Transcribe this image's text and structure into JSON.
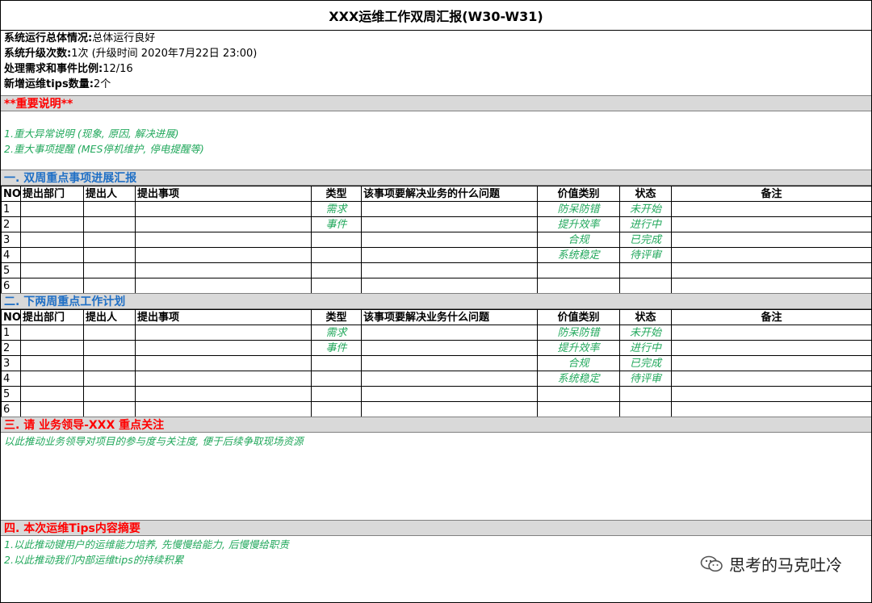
{
  "title": "XXX运维工作双周汇报(W30-W31)",
  "summary": [
    {
      "label": "系统运行总体情况:",
      "value": "总体运行良好"
    },
    {
      "label": "系统升级次数:",
      "value": "1次 (升级时间 2020年7月22日 23:00)"
    },
    {
      "label": "处理需求和事件比例:",
      "value": "12/16"
    },
    {
      "label": "新增运维tips数量:",
      "value": "2个"
    }
  ],
  "important": {
    "heading": "**重要说明**",
    "notes": [
      "1.重大异常说明 (现象, 原因, 解决进展)",
      "2.重大事项提醒 (MES停机维护, 停电提醒等)"
    ]
  },
  "section1": {
    "heading": "一. 双周重点事项进展汇报",
    "columns": [
      "NO",
      "提出部门",
      "提出人",
      "提出事项",
      "类型",
      "该事项要解决业务的什么问题",
      "价值类别",
      "状态",
      "备注"
    ],
    "rows": [
      {
        "no": "1",
        "type": "需求",
        "value": "防呆防错",
        "status": "未开始"
      },
      {
        "no": "2",
        "type": "事件",
        "value": "提升效率",
        "status": "进行中"
      },
      {
        "no": "3",
        "type": "",
        "value": "合规",
        "status": "已完成"
      },
      {
        "no": "4",
        "type": "",
        "value": "系统稳定",
        "status": "待评审"
      },
      {
        "no": "5",
        "type": "",
        "value": "",
        "status": ""
      },
      {
        "no": "6",
        "type": "",
        "value": "",
        "status": ""
      }
    ]
  },
  "section2": {
    "heading": "二. 下两周重点工作计划",
    "columns": [
      "NO",
      "提出部门",
      "提出人",
      "提出事项",
      "类型",
      "该事项要解决业务什么问题",
      "价值类别",
      "状态",
      "备注"
    ],
    "rows": [
      {
        "no": "1",
        "type": "需求",
        "value": "防呆防错",
        "status": "未开始"
      },
      {
        "no": "2",
        "type": "事件",
        "value": "提升效率",
        "status": "进行中"
      },
      {
        "no": "3",
        "type": "",
        "value": "合规",
        "status": "已完成"
      },
      {
        "no": "4",
        "type": "",
        "value": "系统稳定",
        "status": "待评审"
      },
      {
        "no": "5",
        "type": "",
        "value": "",
        "status": ""
      },
      {
        "no": "6",
        "type": "",
        "value": "",
        "status": ""
      }
    ]
  },
  "section3": {
    "heading": "三. 请 业务领导-XXX 重点关注",
    "note": "以此推动业务领导对项目的参与度与关注度, 便于后续争取现场资源"
  },
  "section4": {
    "heading": "四. 本次运维Tips内容摘要",
    "notes": [
      "1.以此推动键用户的运维能力培养, 先慢慢给能力, 后慢慢给职责",
      "2.以此推动我们内部运维tips的持续积累"
    ]
  },
  "watermark": {
    "text": "思考的马克吐冷",
    "icon": "wechat-icon"
  },
  "colors": {
    "red_heading": "#ff0000",
    "blue_heading": "#1f6fc5",
    "green_note": "#22a85c",
    "band": "#d9d9d9"
  }
}
